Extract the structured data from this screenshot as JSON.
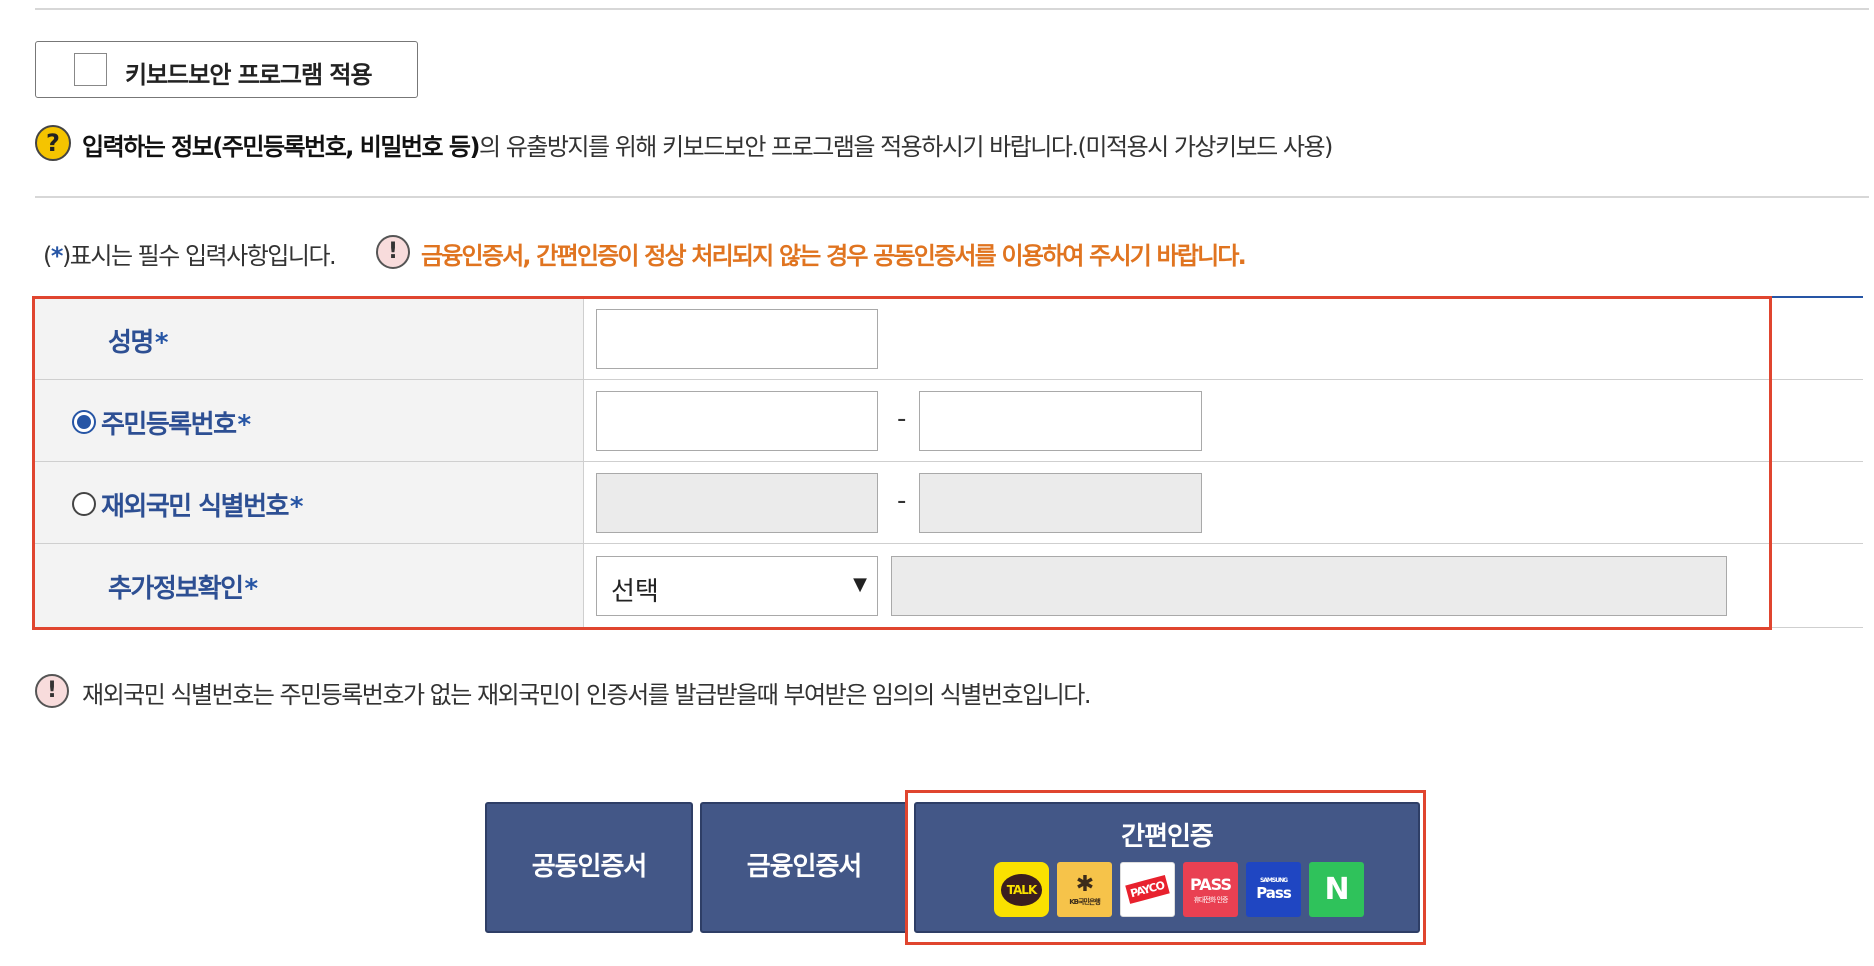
{
  "keyboard_security": {
    "label": "키보드보안 프로그램 적용"
  },
  "notice_keyboard": {
    "bold": "입력하는 정보(주민등록번호, 비밀번호 등)",
    "rest": "의 유출방지를 위해 키보드보안 프로그램을 적용하시기 바랍니다.(미적용시 가상키보드 사용)"
  },
  "required_note": {
    "open": "(",
    "star": "*",
    "rest": ")표시는 필수 입력사항입니다."
  },
  "warning_orange": "금융인증서, 간편인증이 정상 처리되지 않는 경우 공동인증서를 이용하여 주시기 바랍니다.",
  "form": {
    "name_label": "성명",
    "rrn_label": "주민등록번호",
    "foreign_label": "재외국민 식별번호",
    "extra_label": "추가정보확인",
    "star": "*",
    "dash": "-",
    "select_value": "선택",
    "select_arrow": "▼"
  },
  "note_foreign": "재외국민 식별번호는 주민등록번호가 없는 재외국민이 인증서를 발급받을때 부여받은 임의의 식별번호입니다.",
  "buttons": {
    "joint_cert": "공동인증서",
    "finance_cert": "금융인증서",
    "simple_auth": "간편인증"
  },
  "logos": {
    "kakao": "TALK",
    "kb": "KB국민은행",
    "payco": "PAYCO",
    "pass_main": "PASS",
    "pass_sub": "휴대전화 인증",
    "samsung_top": "SAMSUNG",
    "samsung_main": "Pass",
    "naver": "N"
  },
  "icons": {
    "question": "?",
    "exclaim": "!"
  },
  "colors": {
    "primary_blue": "#2655a5",
    "button_blue": "#435787",
    "highlight_red": "#e0452f",
    "warning_orange": "#e07420"
  }
}
